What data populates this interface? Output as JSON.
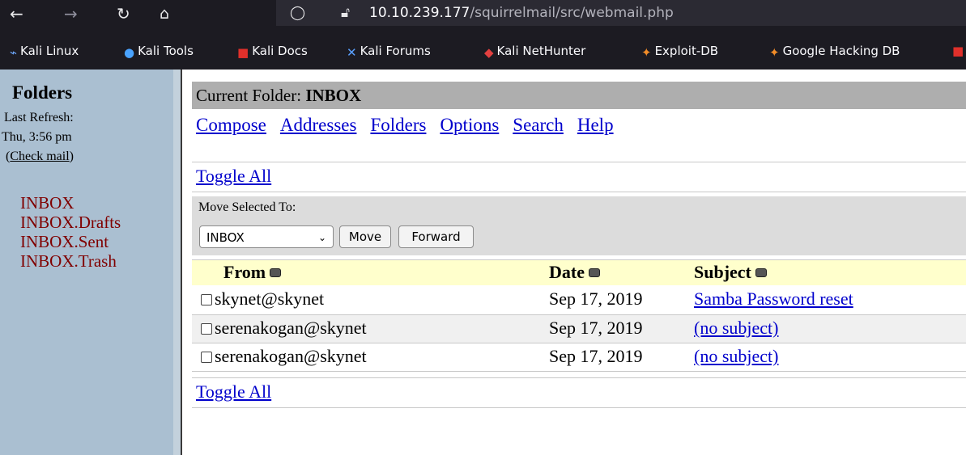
{
  "browser": {
    "url_host": "10.10.239.177",
    "url_path": "/squirrelmail/src/webmail.php",
    "bookmarks": [
      "Kali Linux",
      "Kali Tools",
      "Kali Docs",
      "Kali Forums",
      "Kali NetHunter",
      "Exploit-DB",
      "Google Hacking DB"
    ]
  },
  "sidebar": {
    "title": "Folders",
    "last_refresh_label": "Last Refresh:",
    "last_refresh_time": "Thu, 3:56 pm",
    "check_mail_open": "(",
    "check_mail": "Check mail",
    "check_mail_close": ")",
    "folders": [
      "INBOX",
      "INBOX.Drafts",
      "INBOX.Sent",
      "INBOX.Trash"
    ]
  },
  "main": {
    "current_folder_label": "Current Folder:",
    "current_folder": "INBOX",
    "menu": [
      "Compose",
      "Addresses",
      "Folders",
      "Options",
      "Search",
      "Help"
    ],
    "toggle_all": "Toggle All",
    "move_selected_to": "Move Selected To:",
    "move_target": "INBOX",
    "move_button": "Move",
    "forward_button": "Forward",
    "columns": {
      "from": "From",
      "date": "Date",
      "subject": "Subject"
    },
    "messages": [
      {
        "from": "skynet@skynet",
        "date": "Sep 17, 2019",
        "subject": "Samba Password reset"
      },
      {
        "from": "serenakogan@skynet",
        "date": "Sep 17, 2019",
        "subject": "(no subject)"
      },
      {
        "from": "serenakogan@skynet",
        "date": "Sep 17, 2019",
        "subject": "(no subject)"
      }
    ]
  },
  "colors": {
    "link": "#0000cc",
    "folder_link": "#800000",
    "sidebar_bg": "#aabfd1",
    "header_bg": "#ffffcc"
  }
}
